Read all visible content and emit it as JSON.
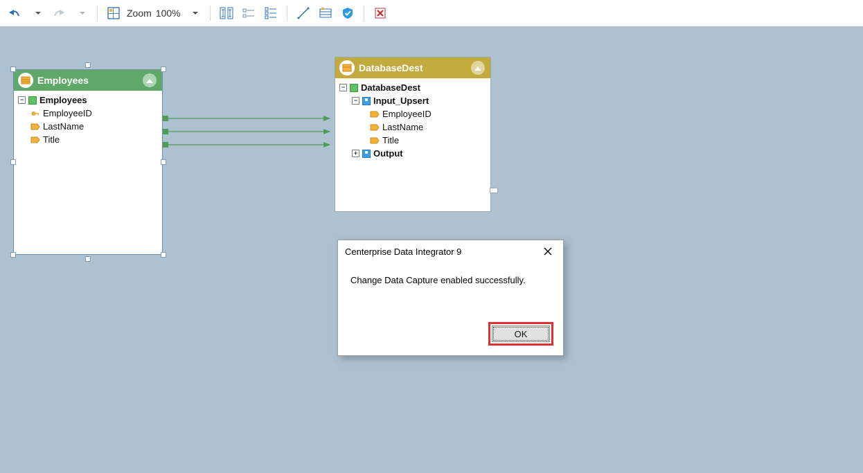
{
  "toolbar": {
    "zoom_label": "Zoom",
    "zoom_value": "100%"
  },
  "nodes": {
    "employees": {
      "title": "Employees",
      "root": "Employees",
      "fields": [
        "EmployeeID",
        "LastName",
        "Title"
      ]
    },
    "databaseDest": {
      "title": "DatabaseDest",
      "root": "DatabaseDest",
      "input_group": "Input_Upsert",
      "fields": [
        "EmployeeID",
        "LastName",
        "Title"
      ],
      "output_group": "Output"
    }
  },
  "dialog": {
    "title": "Centerprise Data Integrator 9",
    "message": "Change Data Capture enabled successfully.",
    "ok": "OK"
  }
}
